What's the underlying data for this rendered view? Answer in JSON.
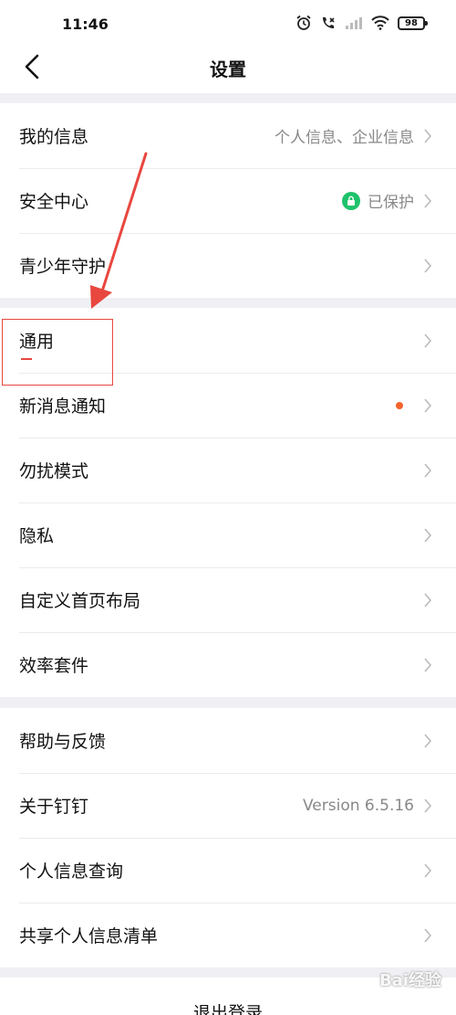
{
  "status_bar": {
    "time": "11:46",
    "battery": "98",
    "icons": [
      "alarm-icon",
      "call-icon",
      "signal-icon",
      "wifi-icon",
      "battery-icon"
    ]
  },
  "header": {
    "title": "设置",
    "back_icon": "chevron-left-icon"
  },
  "groups": [
    {
      "items": [
        {
          "label": "我的信息",
          "value": "个人信息、企业信息"
        },
        {
          "label": "安全中心",
          "value": "已保护",
          "badge": "lock-icon"
        },
        {
          "label": "青少年守护",
          "value": ""
        }
      ]
    },
    {
      "items": [
        {
          "label": "通用",
          "value": ""
        },
        {
          "label": "新消息通知",
          "value": "",
          "dot": true
        },
        {
          "label": "勿扰模式",
          "value": ""
        },
        {
          "label": "隐私",
          "value": ""
        },
        {
          "label": "自定义首页布局",
          "value": ""
        },
        {
          "label": "效率套件",
          "value": ""
        }
      ]
    },
    {
      "items": [
        {
          "label": "帮助与反馈",
          "value": ""
        },
        {
          "label": "关于钉钉",
          "value": "Version 6.5.16"
        },
        {
          "label": "个人信息查询",
          "value": ""
        },
        {
          "label": "共享个人信息清单",
          "value": ""
        }
      ]
    }
  ],
  "logout_label": "退出登录",
  "watermark": "Bai经验",
  "colors": {
    "accent_green": "#1ec26b",
    "notify_dot": "#f4632b",
    "annotation_red": "#e8473f"
  }
}
